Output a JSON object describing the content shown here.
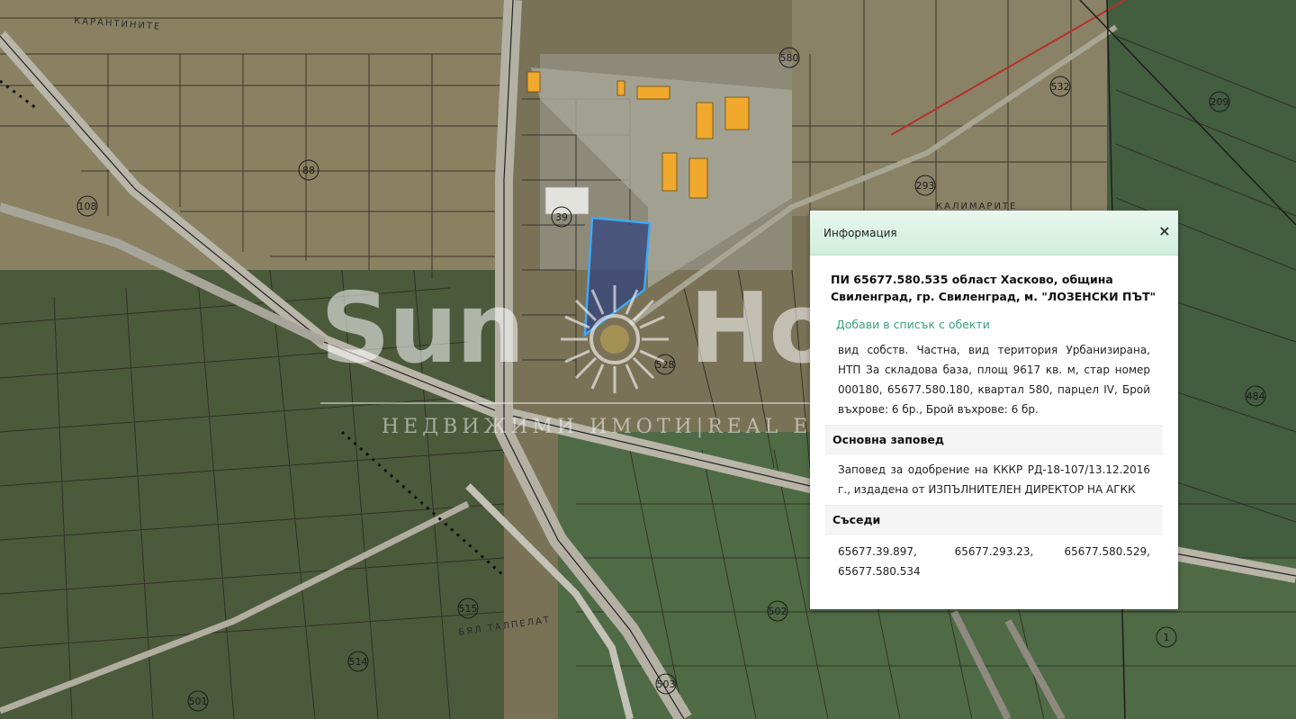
{
  "map": {
    "parcel_numbers": [
      "580",
      "88",
      "108",
      "39",
      "293",
      "209",
      "532",
      "528",
      "484",
      "502",
      "515",
      "514",
      "503",
      "501",
      "1"
    ],
    "road_labels": [
      "КАРАНТИНИТЕ",
      "КАЛИМАРИТЕ",
      "БЯЛ ТАЛПЕЛАТ"
    ],
    "selected_parcel_color": "#3fa9f5",
    "building_color": "#f0a92c"
  },
  "watermark": {
    "brand_left": "Sun",
    "brand_right": "Ho",
    "tagline": "НЕДВИЖИМИ ИМОТИ|REAL E"
  },
  "popup": {
    "title": "Информация",
    "close_label": "×",
    "heading": "ПИ 65677.580.535 област Хасково, община Свиленград, гр. Свиленград, м. \"ЛОЗЕНСКИ ПЪТ\"",
    "add_link": "Добави в списък с обекти",
    "description": "вид собств. Частна, вид територия Урбанизирана, НТП За складова база, площ 9617 кв. м, стар номер 000180, 65677.580.180, квартал 580, парцел IV, Брой въхрове: 6 бр., Брой въхрове: 6 бр.",
    "order_title": "Основна заповед",
    "order_text": "Заповед за одобрение на КККР РД-18-107/13.12.2016 г., издадена от ИЗПЪЛНИТЕЛЕН ДИРЕКТОР НА АГКК",
    "neighbors_title": "Съседи",
    "neighbors": [
      "65677.39.897,",
      "65677.293.23,",
      "65677.580.529,",
      "65677.580.534"
    ]
  }
}
